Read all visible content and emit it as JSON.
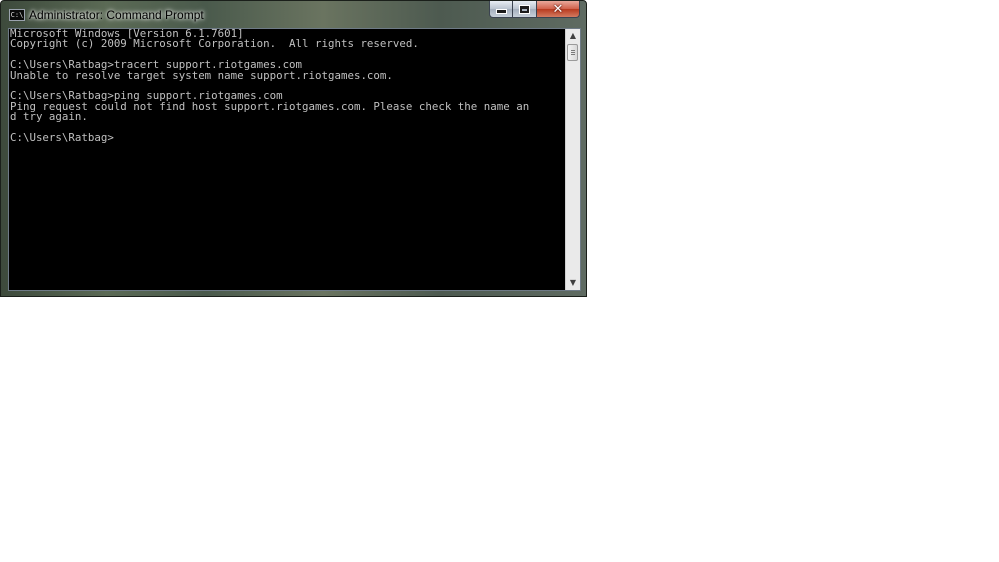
{
  "window": {
    "title": "Administrator: Command Prompt",
    "icon_label": "C:\\",
    "icon": "cmd-icon"
  },
  "caption_buttons": {
    "minimize": "minimize-icon",
    "maximize": "maximize-icon",
    "close_glyph": "✕"
  },
  "console": {
    "lines": [
      "Microsoft Windows [Version 6.1.7601]",
      "Copyright (c) 2009 Microsoft Corporation.  All rights reserved.",
      "",
      "C:\\Users\\Ratbag>tracert support.riotgames.com",
      "Unable to resolve target system name support.riotgames.com.",
      "",
      "C:\\Users\\Ratbag>ping support.riotgames.com",
      "Ping request could not find host support.riotgames.com. Please check the name an",
      "d try again.",
      "",
      "C:\\Users\\Ratbag>"
    ],
    "text_color": "#c0c0c0",
    "background_color": "#000000"
  },
  "scrollbar": {
    "up_arrow": "▲",
    "down_arrow": "▼"
  }
}
